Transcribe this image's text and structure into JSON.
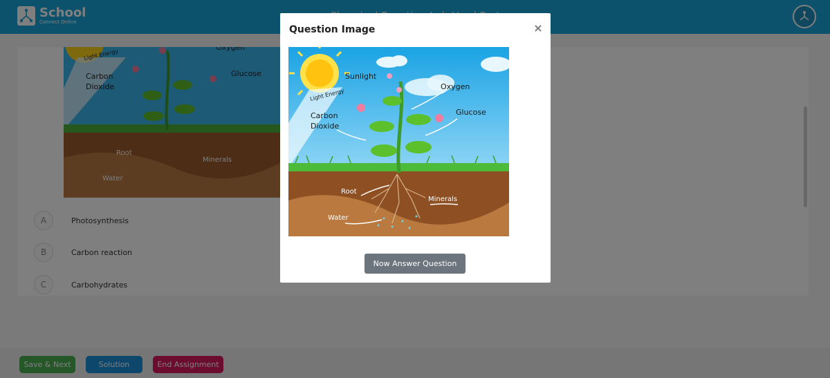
{
  "header": {
    "logo_name": "School",
    "logo_sub": "Connect Online",
    "title": "Chemical Reaction Lab Hard Part"
  },
  "diagram_labels": {
    "sunlight": "Sunlight",
    "light_energy": "Light Energy",
    "oxygen": "Oxygen",
    "carbon": "Carbon",
    "dioxide": "Dioxide",
    "glucose": "Glucose",
    "root": "Root",
    "minerals": "Minerals",
    "water": "Water"
  },
  "options": [
    {
      "letter": "A",
      "text": "Photosynthesis"
    },
    {
      "letter": "B",
      "text": "Carbon reaction"
    },
    {
      "letter": "C",
      "text": "Carbohydrates"
    }
  ],
  "footer": {
    "save_next": "Save & Next",
    "solution": "Solution",
    "end_assignment": "End Assignment"
  },
  "modal": {
    "title": "Question Image",
    "close_symbol": "×",
    "answer_button": "Now Answer Question"
  },
  "colors": {
    "header": "#1aa5d8",
    "save": "#4caf50",
    "solution": "#1a8fd6",
    "end": "#d81b60",
    "modal_button": "#6c757d"
  }
}
